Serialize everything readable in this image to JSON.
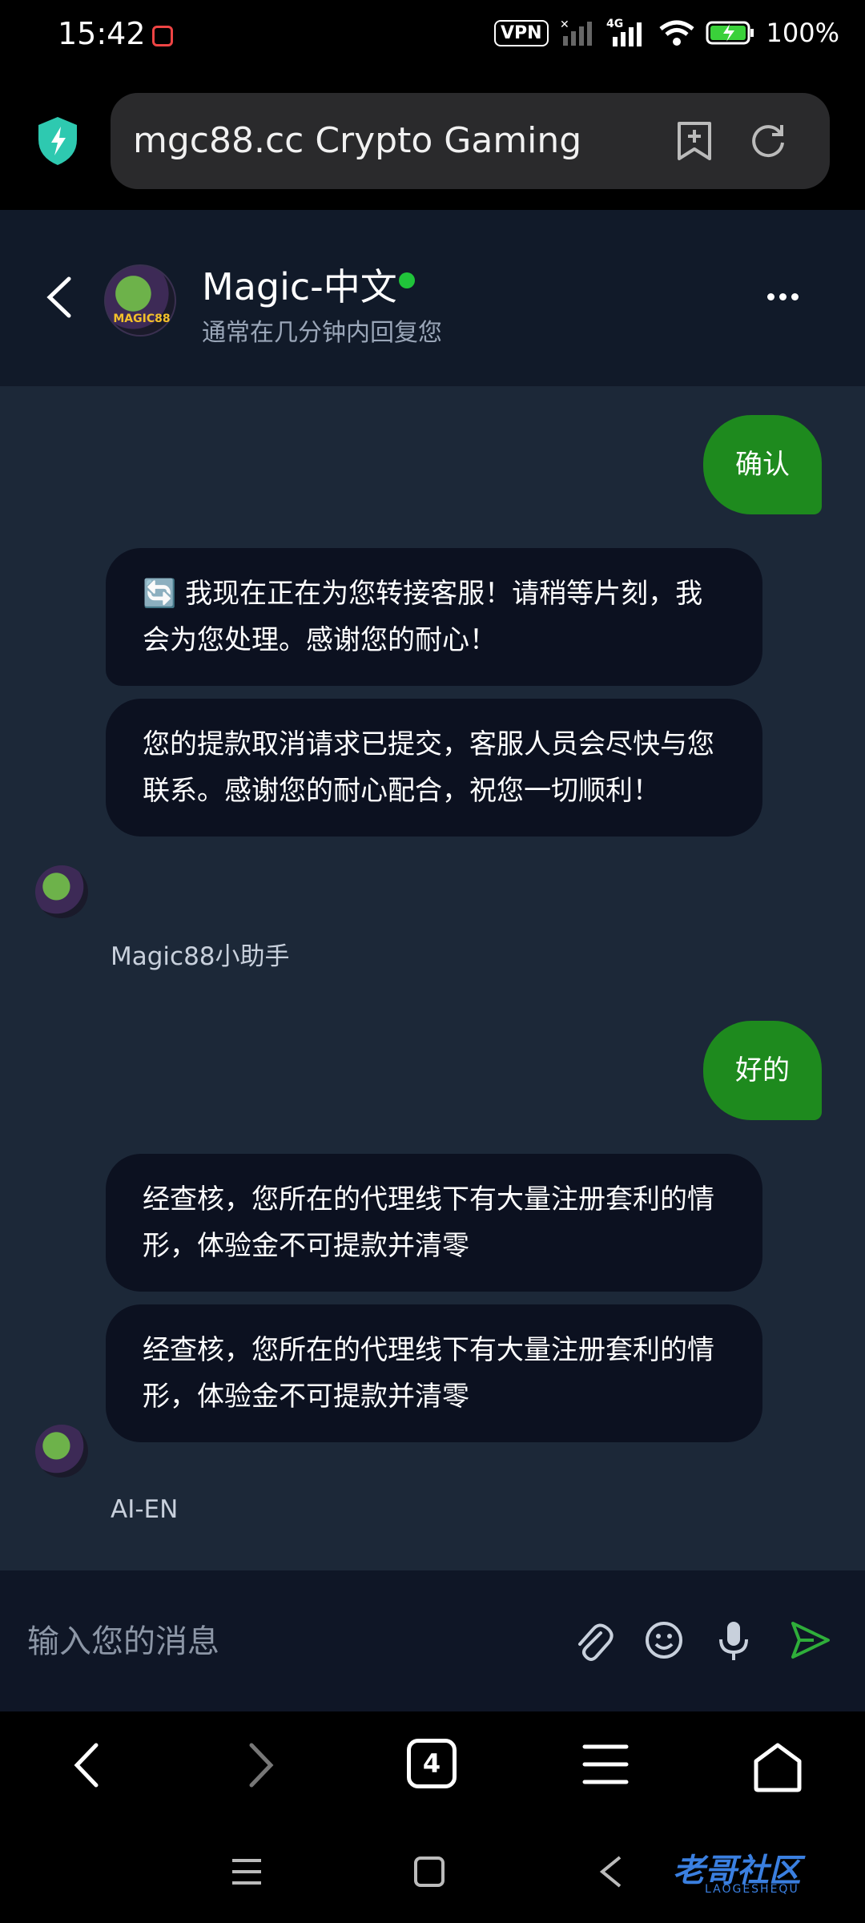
{
  "status_bar": {
    "time": "15:42",
    "vpn": "VPN",
    "network": "4G",
    "battery": "100%"
  },
  "browser": {
    "url_title": "mgc88.cc Crypto Gaming",
    "tab_count": "4"
  },
  "chat_header": {
    "title": "Magic-中文",
    "subtitle": "通常在几分钟内回复您",
    "online_color": "#20c33a",
    "avatar_logo": "MAGIC88"
  },
  "messages": [
    {
      "from": "user",
      "text": "确认"
    },
    {
      "from": "bot",
      "text": "🔄 我现在正在为您转接客服！请稍等片刻，我会为您处理。感谢您的耐心！"
    },
    {
      "from": "bot",
      "text": "您的提款取消请求已提交，客服人员会尽快与您联系。感谢您的耐心配合，祝您一切顺利！"
    },
    {
      "from": "bot_name",
      "text": "Magic88小助手"
    },
    {
      "from": "user",
      "text": "好的"
    },
    {
      "from": "bot",
      "text": "经查核，您所在的代理线下有大量注册套利的情形，体验金不可提款并清零"
    },
    {
      "from": "bot",
      "text": "经查核，您所在的代理线下有大量注册套利的情形，体验金不可提款并清零"
    },
    {
      "from": "bot_name",
      "text": "AI-EN"
    }
  ],
  "input": {
    "placeholder": "输入您的消息"
  },
  "watermark": {
    "text": "老哥社区",
    "sub": "LAOGESHEQU"
  },
  "colors": {
    "user_bubble": "#1e8a1e",
    "bot_bubble": "#0c1120",
    "chat_bg": "#1c2838",
    "send_icon": "#2fae3a"
  }
}
